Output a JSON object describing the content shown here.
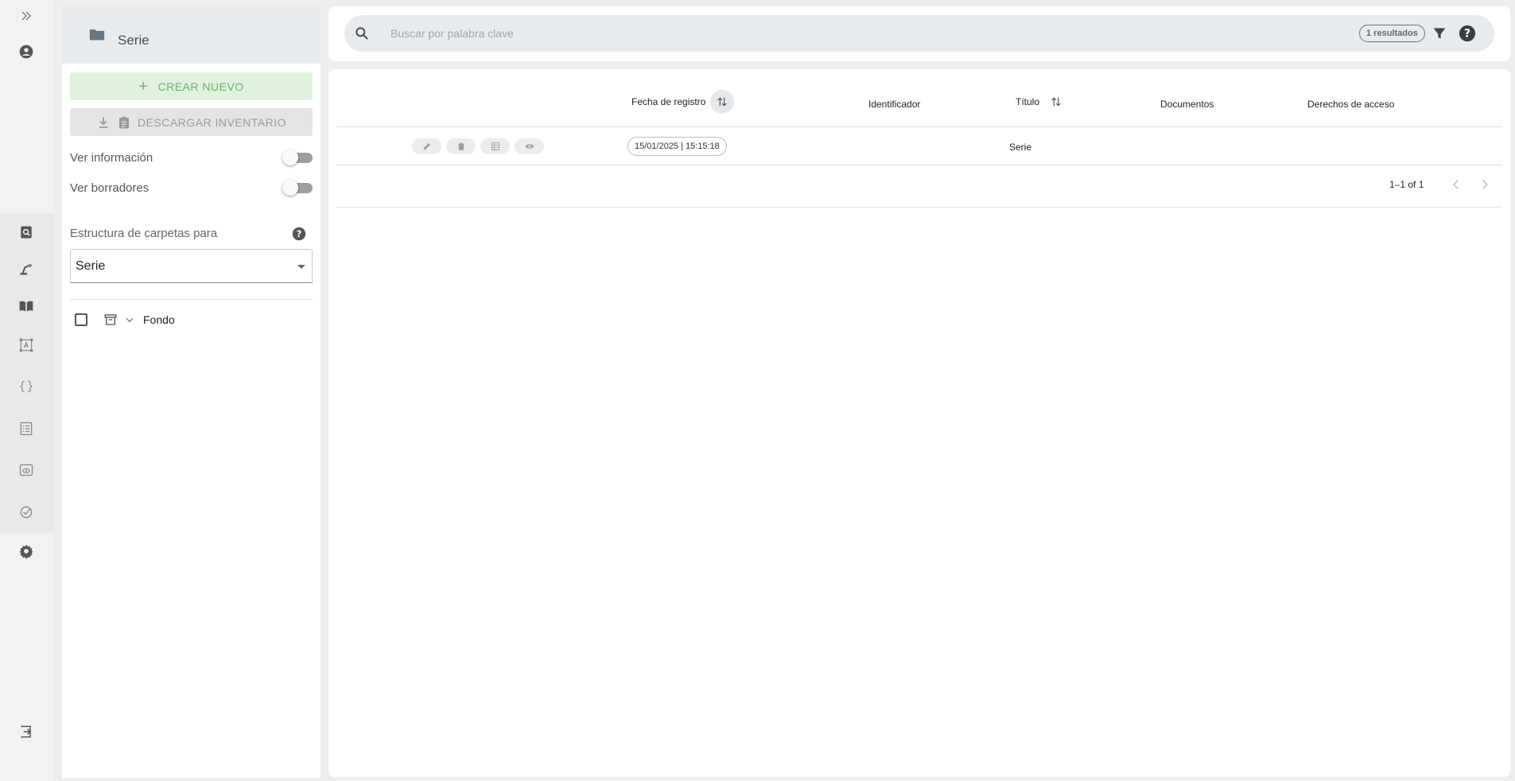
{
  "rail": {
    "icons": [
      "expand-icon",
      "account-icon",
      "search-document-icon",
      "robot-arm-icon",
      "book-icon",
      "text-box-icon",
      "code-braces-icon",
      "list-icon",
      "preview-icon",
      "check-circle-icon",
      "settings-icon",
      "logout-icon"
    ]
  },
  "panel": {
    "title": "Serie",
    "create_label": "CREAR NUEVO",
    "download_label": "DESCARGAR INVENTARIO",
    "toggles": [
      {
        "label": "Ver información",
        "on": false
      },
      {
        "label": "Ver borradores",
        "on": false
      }
    ],
    "structure_label": "Estructura de carpetas para",
    "structure_value": "Serie",
    "tree": [
      {
        "label": "Fondo"
      }
    ]
  },
  "search": {
    "placeholder": "Buscar por palabra clave",
    "value": "",
    "results_badge": "1 resultados"
  },
  "table": {
    "columns": [
      "Fecha de registro",
      "Identificador",
      "Título",
      "Documentos",
      "Derechos de acceso"
    ],
    "rows": [
      {
        "fecha": "15/01/2025 | 15:15:18",
        "identificador": "",
        "titulo": "Serie",
        "documentos": "",
        "derechos": ""
      }
    ],
    "row_actions": [
      "edit-icon",
      "delete-icon",
      "table-icon",
      "eye-icon"
    ],
    "pagination": "1–1 of 1"
  },
  "colors": {
    "accent_green": "#6fb06b",
    "panel_bg": "#e8ebed"
  }
}
